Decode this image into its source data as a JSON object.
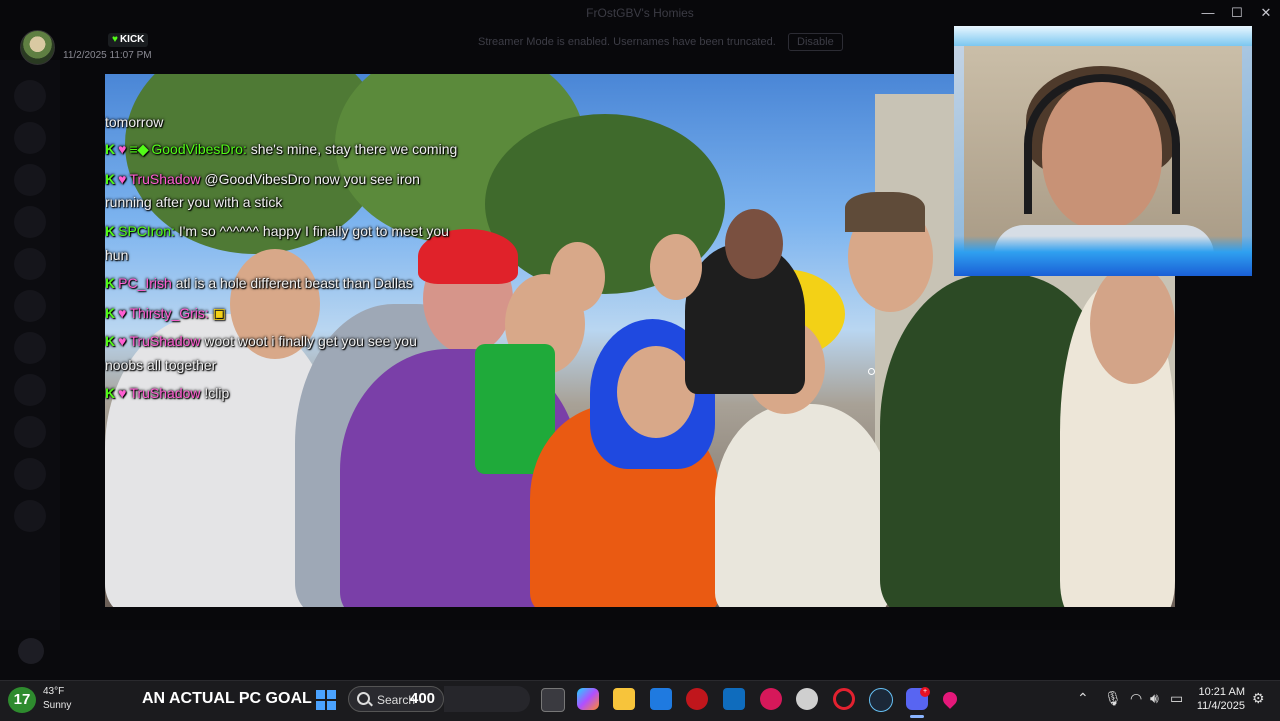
{
  "window": {
    "title": "FrOstGBV's Homies",
    "controls": [
      "minimize",
      "maximize",
      "close"
    ]
  },
  "banner": {
    "message": "Streamer Mode is enabled. Usernames have been truncated.",
    "button_label": "Disable"
  },
  "message": {
    "platform_badge": "KICK",
    "timestamp": "11/2/2025 11:07 PM"
  },
  "chat": [
    {
      "user": "",
      "text": "tomorrow",
      "badges": []
    },
    {
      "user": "GoodVibesDro:",
      "text": "she's mine, stay there we coming",
      "badges": [
        "K",
        "heart",
        "sub"
      ]
    },
    {
      "user": "TruShadow",
      "text": "@GoodVibesDro now you see iron",
      "badges": [
        "K",
        "heart"
      ]
    },
    {
      "user": "",
      "text": "running after you with a stick",
      "badges": []
    },
    {
      "user": "SPCIron:",
      "text": "I'm so ^^^^^^ happy I finally got to meet you",
      "badges": [
        "K"
      ]
    },
    {
      "user": "",
      "text": "hun",
      "badges": []
    },
    {
      "user": "PC_Irish",
      "text": "atl is a hole different beast than Dallas",
      "badges": [
        "K"
      ]
    },
    {
      "user": "Thirsty_Gris:",
      "text": "",
      "badges": [
        "K",
        "heart"
      ]
    },
    {
      "user": "TruShadow",
      "text": "woot woot i finally get you see you",
      "badges": [
        "K",
        "heart"
      ]
    },
    {
      "user": "",
      "text": "noobs all together",
      "badges": []
    },
    {
      "user": "TruShadow",
      "text": "!clip",
      "badges": [
        "K",
        "heart"
      ]
    }
  ],
  "taskbar": {
    "weather": {
      "badge": "17",
      "temp": "43°F",
      "condition": "Sunny"
    },
    "goal_text": "AN ACTUAL PC GOAL",
    "search_label": "Search",
    "search_count": "400",
    "apps": [
      "task-view",
      "copilot",
      "file-explorer",
      "store",
      "game",
      "outlook",
      "app-red",
      "chrome",
      "opera",
      "steam",
      "discord",
      "maps"
    ],
    "clock_time": "10:21 AM",
    "clock_date": "11/4/2025"
  },
  "colors": {
    "kick_green": "#53fc18",
    "chat_pink": "#ff5fd2",
    "taskbar_bg": "#1b1b1e",
    "weather_green": "#2e8b2e"
  }
}
